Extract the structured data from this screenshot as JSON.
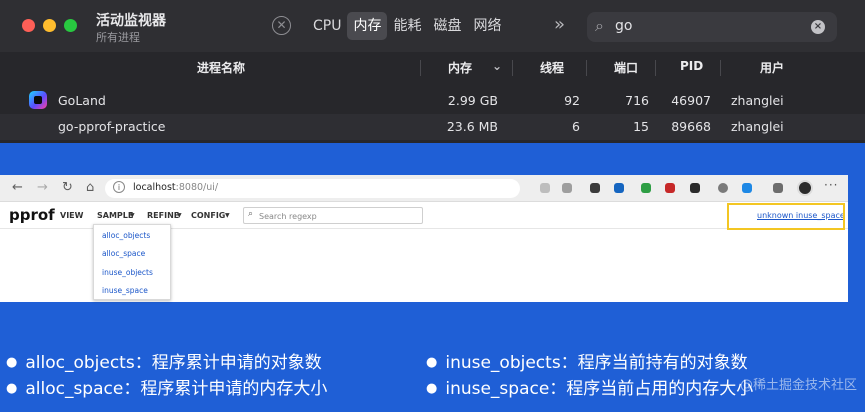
{
  "activity_monitor": {
    "title": "活动监视器",
    "subtitle": "所有进程",
    "tabs": [
      {
        "label": "CPU",
        "active": false
      },
      {
        "label": "内存",
        "active": true
      },
      {
        "label": "能耗",
        "active": false
      },
      {
        "label": "磁盘",
        "active": false
      },
      {
        "label": "网络",
        "active": false
      }
    ],
    "search_value": "go",
    "columns": {
      "name": "进程名称",
      "memory": "内存",
      "threads": "线程",
      "ports": "端口",
      "pid": "PID",
      "user": "用户"
    },
    "rows": [
      {
        "name": "GoLand",
        "memory": "2.99 GB",
        "threads": "92",
        "ports": "716",
        "pid": "46907",
        "user": "zhanglei"
      },
      {
        "name": "go-pprof-practice",
        "memory": "23.6 MB",
        "threads": "6",
        "ports": "15",
        "pid": "89668",
        "user": "zhanglei"
      }
    ]
  },
  "browser": {
    "url_host": "localhost",
    "url_rest": ":8080/ui/",
    "pprof": {
      "logo": "pprof",
      "menus": [
        "VIEW",
        "SAMPLE",
        "REFINE",
        "CONFIG"
      ],
      "search_placeholder": "Search regexp",
      "status_link": "unknown inuse_space",
      "sample_options": [
        "alloc_objects",
        "alloc_space",
        "inuse_objects",
        "inuse_space"
      ]
    }
  },
  "notes": [
    "alloc_objects：程序累计申请的对象数",
    "inuse_objects：程序当前持有的对象数",
    "alloc_space：程序累计申请的内存大小",
    "inuse_space：程序当前占用的内存大小"
  ],
  "watermark": "@稀土掘金技术社区",
  "colors": {
    "accent_blue": "#1f5fd6",
    "highlight": "#f3c623"
  }
}
